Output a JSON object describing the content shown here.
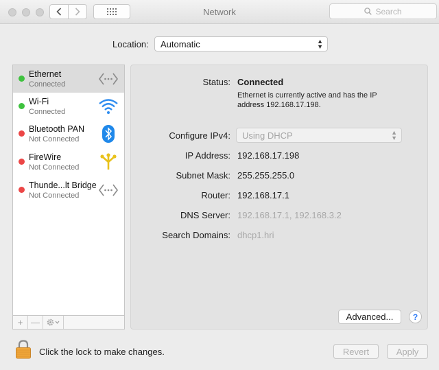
{
  "window": {
    "title": "Network",
    "search_placeholder": "Search",
    "grid_icon": "grid-icon"
  },
  "location": {
    "label": "Location:",
    "value": "Automatic"
  },
  "services": [
    {
      "name": "Ethernet",
      "status": "Connected",
      "color": "#3fc23f",
      "icon": "ethernet-icon"
    },
    {
      "name": "Wi-Fi",
      "status": "Connected",
      "color": "#3fc23f",
      "icon": "wifi-icon"
    },
    {
      "name": "Bluetooth PAN",
      "status": "Not Connected",
      "color": "#ec4747",
      "icon": "bluetooth-icon"
    },
    {
      "name": "FireWire",
      "status": "Not Connected",
      "color": "#ec4747",
      "icon": "firewire-icon"
    },
    {
      "name": "Thunde...lt Bridge",
      "status": "Not Connected",
      "color": "#ec4747",
      "icon": "thunderbolt-bridge-icon"
    }
  ],
  "sidebar_controls": {
    "add": "+",
    "remove": "—"
  },
  "detail": {
    "status_label": "Status:",
    "status_value": "Connected",
    "status_desc": "Ethernet is currently active and has the IP address 192.168.17.198.",
    "configure_label": "Configure IPv4:",
    "configure_value": "Using DHCP",
    "ip_label": "IP Address:",
    "ip_value": "192.168.17.198",
    "subnet_label": "Subnet Mask:",
    "subnet_value": "255.255.255.0",
    "router_label": "Router:",
    "router_value": "192.168.17.1",
    "dns_label": "DNS Server:",
    "dns_value": "192.168.17.1, 192.168.3.2",
    "search_domains_label": "Search Domains:",
    "search_domains_value": "dhcp1.hri",
    "advanced_label": "Advanced...",
    "help_label": "?"
  },
  "footer": {
    "lock_text": "Click the lock to make changes.",
    "revert_label": "Revert",
    "apply_label": "Apply"
  }
}
